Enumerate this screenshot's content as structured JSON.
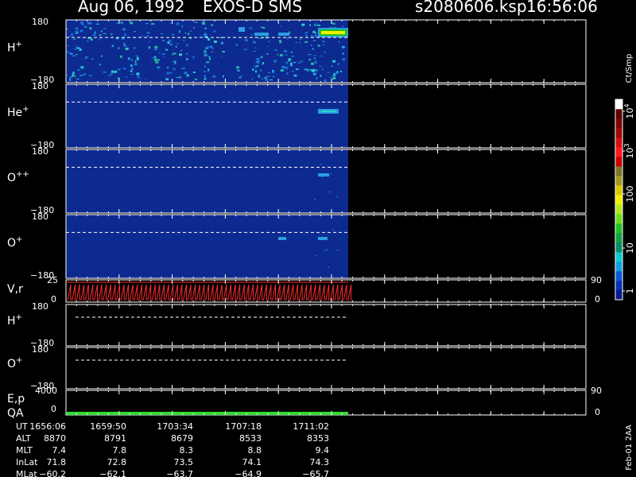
{
  "header": {
    "date": "Aug 06, 1992",
    "instrument": "EXOS-D SMS",
    "filename": "s2080606.ksp",
    "time": "16:56:06"
  },
  "colors": {
    "background": "#000000",
    "panel_fill": "#0c2a90",
    "frame": "#ffffff",
    "vr_trace": "#ff2a2a",
    "qa_bar": "#33dd33"
  },
  "colorbar": {
    "unit_label": "Ct/Smp",
    "tick_labels": [
      "1",
      "10",
      "100",
      "10",
      "10"
    ],
    "tick_exponents": [
      "",
      "",
      "",
      "3",
      "4"
    ],
    "colors_bottom_to_top": [
      "#0a1a8c",
      "#0830b4",
      "#0c58d8",
      "#10a0e0",
      "#10c8d0",
      "#0a8c64",
      "#10a040",
      "#20c020",
      "#6cdc20",
      "#b4e820",
      "#f0f000",
      "#d8c800",
      "#a09820",
      "#7c7428",
      "#c80000",
      "#ff1818",
      "#d01010",
      "#a00808",
      "#7c0404",
      "#5c0000",
      "#ffffff"
    ]
  },
  "panels": [
    {
      "label": "H",
      "sup": "+",
      "ymax": "180",
      "ymin": "−180"
    },
    {
      "label": "He",
      "sup": "+",
      "ymax": "180",
      "ymin": "−180"
    },
    {
      "label": "O",
      "sup": "++",
      "ymax": "180",
      "ymin": "−180"
    },
    {
      "label": "O",
      "sup": "+",
      "ymax": "180",
      "ymin": "−180"
    }
  ],
  "vr_panel": {
    "label": "V,r",
    "left_max": "25",
    "left_min": "0",
    "right_max": "90",
    "right_min": "0"
  },
  "line_panels": [
    {
      "label": "H",
      "sup": "+",
      "ymax": "180",
      "ymin": "−180"
    },
    {
      "label": "O",
      "sup": "+",
      "ymax": "180",
      "ymin": "−180"
    }
  ],
  "ep_panel": {
    "label1": "E,p",
    "label2": "QA",
    "left_max": "4000",
    "left_min": "0",
    "right_max": "90",
    "right_min": "0"
  },
  "ephemeris": {
    "row_labels": [
      "UT",
      "ALT",
      "MLT",
      "InLat",
      "MLat"
    ],
    "columns": [
      [
        "1656:06",
        "8870",
        "7.4",
        "71.8",
        "−60.2"
      ],
      [
        "1659:50",
        "8791",
        "7.8",
        "72.8",
        "−62.1"
      ],
      [
        "1703:34",
        "8679",
        "8.3",
        "73.5",
        "−63.7"
      ],
      [
        "1707:18",
        "8533",
        "8.8",
        "74.1",
        "−64.9"
      ],
      [
        "1711:02",
        "8353",
        "9.4",
        "74.3",
        "−65.7"
      ]
    ]
  },
  "footer_stamp": "Feb-01 2AA",
  "chart_data": {
    "type": "heatmap",
    "title": "Aug 06, 1992   EXOS-D SMS",
    "xlabel": "",
    "ylabel": "",
    "x_tick_labels": [
      "1656:06",
      "1659:50",
      "1703:34",
      "1707:18",
      "1711:02"
    ],
    "ylim": [
      -180,
      180
    ],
    "colorbar_label": "Ct/Smp",
    "colorbar_range": [
      1,
      10000
    ],
    "colorbar_scale": "log",
    "series": [
      {
        "name": "H+"
      },
      {
        "name": "He+"
      },
      {
        "name": "O++"
      },
      {
        "name": "O+"
      }
    ],
    "vr_ylim": [
      0,
      25
    ],
    "vr_right_ylim": [
      0,
      90
    ],
    "ep_ylim": [
      0,
      4000
    ],
    "ep_right_ylim": [
      0,
      90
    ],
    "grid": false
  }
}
